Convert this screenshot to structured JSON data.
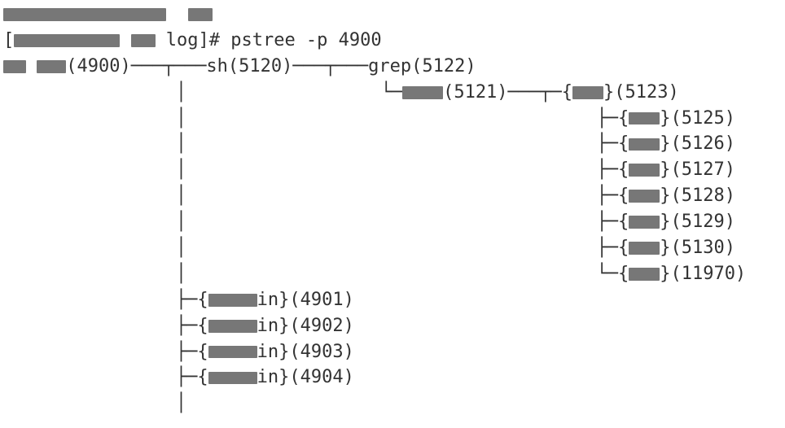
{
  "prompt": {
    "cwd": "log",
    "cmd": "pstree -p 4900",
    "sep": "]# "
  },
  "root": {
    "pid": "4900",
    "suffix": "(4900)"
  },
  "sh": {
    "label": "sh",
    "pid": "5120"
  },
  "grep": {
    "label": "grep",
    "pid": "5122"
  },
  "redacted_child_pid": "5121",
  "threads_a": [
    {
      "pid": "5123"
    },
    {
      "pid": "5125"
    },
    {
      "pid": "5126"
    },
    {
      "pid": "5127"
    },
    {
      "pid": "5128"
    },
    {
      "pid": "5129"
    },
    {
      "pid": "5130"
    },
    {
      "pid": "11970"
    }
  ],
  "threads_b": [
    {
      "suffix": "in",
      "pid": "4901"
    },
    {
      "suffix": "in",
      "pid": "4902"
    },
    {
      "suffix": "in",
      "pid": "4903"
    },
    {
      "suffix": "in",
      "pid": "4904"
    }
  ],
  "tree": {
    "tee": "├─",
    "elb": "└─",
    "vbar": "│ ",
    "dash": "───"
  }
}
